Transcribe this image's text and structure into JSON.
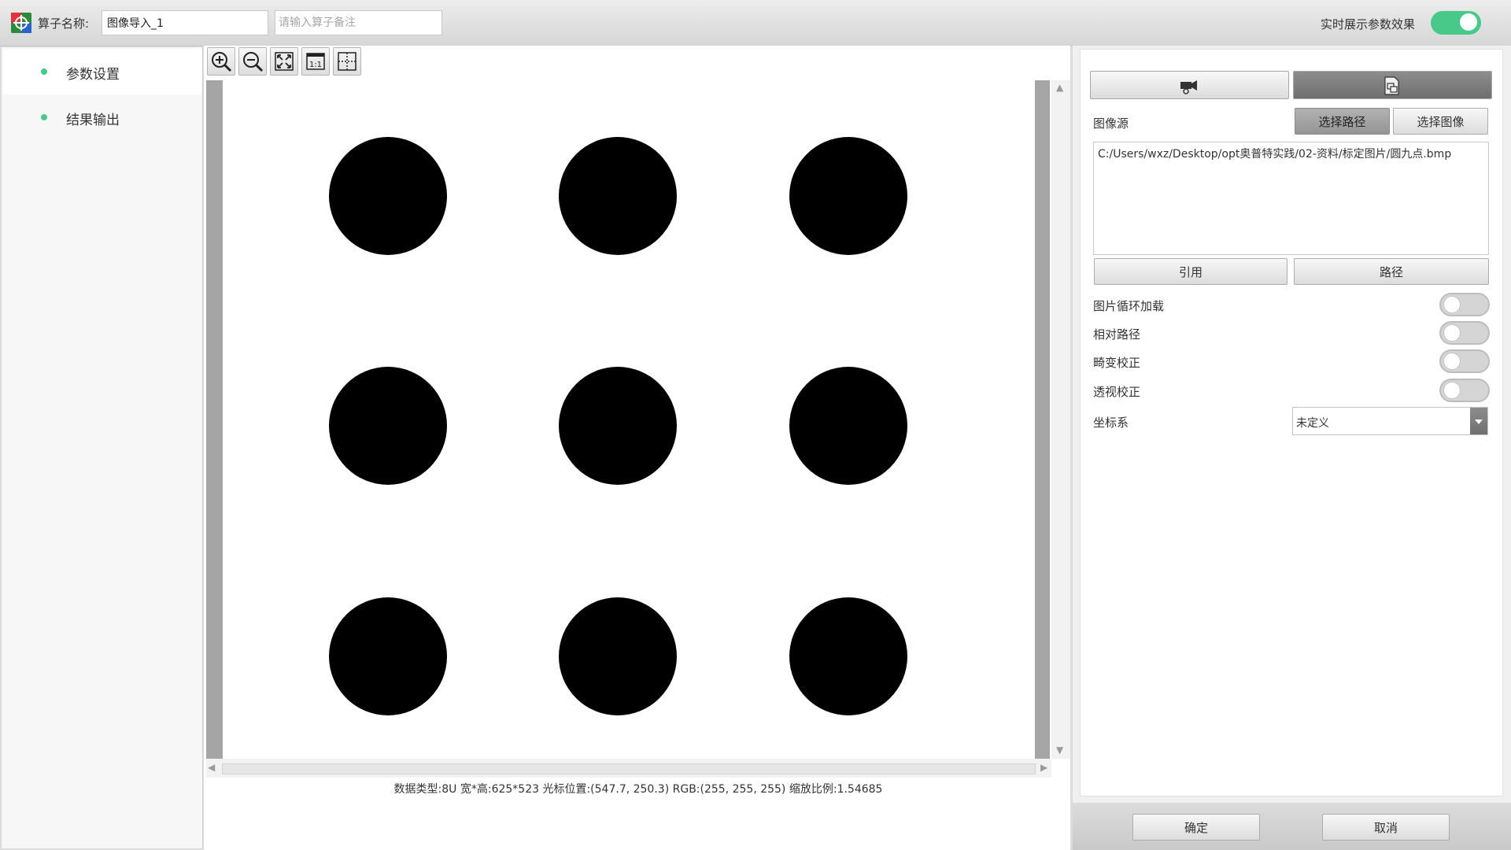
{
  "topbar": {
    "name_label": "算子名称:",
    "name_value": "图像导入_1",
    "note_placeholder": "请输入算子备注",
    "realtime_label": "实时展示参数效果",
    "realtime_on": true
  },
  "sidebar": {
    "items": [
      {
        "label": "参数设置",
        "active": true
      },
      {
        "label": "结果输出",
        "active": false
      }
    ]
  },
  "toolbar": {
    "buttons": [
      "zoom-in-icon",
      "zoom-out-icon",
      "fit-screen-icon",
      "actual-size-icon",
      "crosshair-icon"
    ],
    "actual_size_text": "1:1"
  },
  "canvas": {
    "grid_rows": 3,
    "grid_cols": 3,
    "dot_color": "#000000",
    "background": "#ffffff"
  },
  "status": {
    "text": "数据类型:8U 宽*高:625*523 光标位置:(547.7, 250.3) RGB:(255, 255, 255) 缩放比例:1.54685"
  },
  "right_panel": {
    "source_tabs": [
      {
        "icon": "camera-icon",
        "active": false
      },
      {
        "icon": "file-image-icon",
        "active": true
      }
    ],
    "image_source_label": "图像源",
    "select_path_button": "选择路径",
    "select_image_button": "选择图像",
    "path_value": "C:/Users/wxz/Desktop/opt奥普特实践/02-资料/标定图片/圆九点.bmp",
    "reference_button": "引用",
    "path_button": "路径",
    "toggles": [
      {
        "label": "图片循环加载",
        "on": false
      },
      {
        "label": "相对路径",
        "on": false
      },
      {
        "label": "畸变校正",
        "on": false
      },
      {
        "label": "透视校正",
        "on": false
      }
    ],
    "coord_label": "坐标系",
    "coord_value": "未定义"
  },
  "footer": {
    "ok_button": "确定",
    "cancel_button": "取消"
  }
}
